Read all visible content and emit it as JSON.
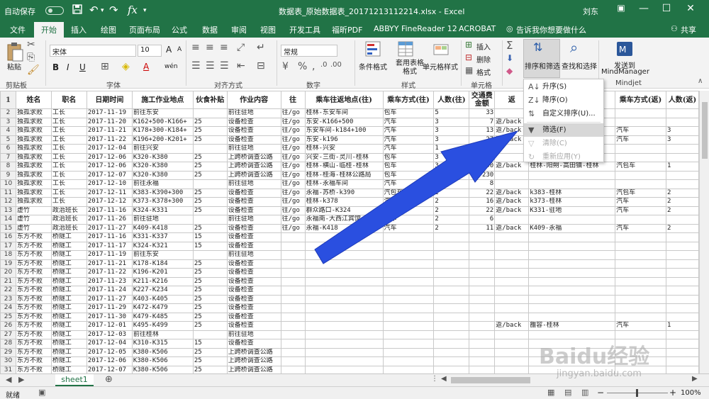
{
  "title_bar": {
    "autosave_label": "自动保存",
    "autosave_state": "关",
    "file_title": "数据表_原始数据表_20171213112214.xlsx - Excel",
    "user": "刘东",
    "accent": "#217346"
  },
  "ribbon_tabs": [
    "文件",
    "开始",
    "插入",
    "绘图",
    "页面布局",
    "公式",
    "数据",
    "审阅",
    "视图",
    "开发工具",
    "福昕PDF",
    "ABBYY FineReader 12",
    "ACROBAT",
    "告诉我你想要做什么"
  ],
  "share_label": "共享",
  "ribbon": {
    "clipboard": {
      "paste": "粘贴",
      "group": "剪贴板"
    },
    "font": {
      "name": "宋体",
      "size": "10",
      "bold": "B",
      "italic": "I",
      "underline": "U",
      "grow": "A",
      "shrink": "A",
      "phonetic": "wén",
      "group": "字体"
    },
    "alignment": {
      "group": "对齐方式"
    },
    "number": {
      "format": "常规",
      "group": "数字"
    },
    "styles": {
      "conditional": "条件格式",
      "table": "套用表格格式",
      "cell": "单元格样式",
      "group": "样式"
    },
    "cells": {
      "insert": "插入",
      "delete": "删除",
      "format": "格式",
      "group": "单元格"
    },
    "editing": {
      "sort_filter": "排序和筛选",
      "find": "查找和选择",
      "group": "编辑"
    },
    "mindjet": {
      "send": "发送到",
      "app": "MindManager",
      "group": "Mindjet"
    }
  },
  "sort_menu": {
    "items": [
      {
        "label": "升序(S)",
        "icon": "sort-ascending-icon",
        "enabled": true
      },
      {
        "label": "降序(O)",
        "icon": "sort-descending-icon",
        "enabled": true
      },
      {
        "label": "自定义排序(U)...",
        "icon": "custom-sort-icon",
        "enabled": true
      },
      {
        "label": "筛选(F)",
        "icon": "filter-icon",
        "enabled": true
      },
      {
        "label": "清除(C)",
        "icon": "clear-filter-icon",
        "enabled": false
      },
      {
        "label": "重新应用(Y)",
        "icon": "reapply-icon",
        "enabled": false
      }
    ]
  },
  "sheet": {
    "headers": [
      "姓名",
      "职名",
      "日期时间",
      "施工作业地点",
      "伙食补贴",
      "作业内容",
      "往",
      "乘车往返地点(往)",
      "乘车方式(往)",
      "人数(往)",
      "交通费金额",
      "返",
      "乘车往返地点(返)",
      "乘车方式(返)",
      "人数(返)"
    ],
    "rows": [
      [
        "独孤求败",
        "工长",
        "2017-11-19",
        "前往东安",
        "",
        "前往驻地",
        "往/go",
        "桂林-东安车间",
        "包车",
        "5",
        "33",
        "",
        "",
        "",
        ""
      ],
      [
        "独孤求败",
        "工长",
        "2017-11-20",
        "K162+500-K166+",
        "25",
        "设备检查",
        "往/go",
        "东安-K166+500",
        "汽车",
        "3",
        "7",
        "返/back",
        "",
        "",
        ""
      ],
      [
        "独孤求败",
        "工长",
        "2017-11-21",
        "K178+300-K184+",
        "25",
        "设备检查",
        "往/go",
        "东安车间-k184+100",
        "汽车",
        "3",
        "13",
        "返/back",
        "",
        "汽车",
        "3"
      ],
      [
        "独孤求败",
        "工长",
        "2017-11-22",
        "K196+200-K201+",
        "25",
        "设备检查",
        "往/go",
        "东安-k196",
        "汽车",
        "3",
        "27",
        "返/back",
        "",
        "汽车",
        "3"
      ],
      [
        "独孤求败",
        "工长",
        "2017-12-04",
        "前往兴安",
        "",
        "前往驻地",
        "往/go",
        "桂林-兴安",
        "汽车",
        "1",
        "20",
        "",
        "",
        "",
        ""
      ],
      [
        "独孤求败",
        "工长",
        "2017-12-06",
        "K320-K380",
        "25",
        "上跨桥调查公路",
        "往/go",
        "兴安-三街-灵川-桂林",
        "包车",
        "3",
        "330",
        "",
        "",
        "",
        ""
      ],
      [
        "独孤求败",
        "工长",
        "2017-12-06",
        "K320-K380",
        "25",
        "上跨桥调查公路",
        "往/go",
        "桂林-横山-临桂-桂林",
        "包车",
        "3",
        "190",
        "返/back",
        "桂林-阳朔-高田镇-桂林",
        "汽包车",
        "1"
      ],
      [
        "独孤求败",
        "工长",
        "2017-12-07",
        "K320-K380",
        "25",
        "上跨桥调查公路",
        "往/go",
        "桂林-桂海-桂林公路局",
        "包车",
        "3",
        "230",
        "",
        "",
        "",
        ""
      ],
      [
        "独孤求败",
        "工长",
        "2017-12-10",
        "前往永福",
        "",
        "前往驻地",
        "往/go",
        "桂林-永福车间",
        "汽车",
        "",
        "8",
        "",
        "",
        "",
        ""
      ],
      [
        "独孤求败",
        "工长",
        "2017-12-11",
        "K383-K390+300",
        "25",
        "设备检查",
        "往/go",
        "永福-苏桥-k390",
        "汽包车",
        "2",
        "22",
        "返/back",
        "k383-桂林",
        "汽包车",
        "2"
      ],
      [
        "独孤求败",
        "工长",
        "2017-12-12",
        "K373-K378+300",
        "25",
        "设备检查",
        "往/go",
        "桂林-k378",
        "汽车",
        "2",
        "16",
        "返/back",
        "k373-桂林",
        "汽车",
        "2"
      ],
      [
        "虚竹",
        "政治班长",
        "2017-11-16",
        "K324-K331",
        "25",
        "设备检查",
        "往/go",
        "群众路口-K324",
        "汽车",
        "2",
        "22",
        "返/back",
        "K331-驻地",
        "汽车",
        "2"
      ],
      [
        "虚竹",
        "政治班长",
        "2017-11-26",
        "前往驻地",
        "",
        "前往驻地",
        "往/go",
        "永福南-大西江宾馆",
        "汽车",
        "2",
        "6",
        "",
        "",
        "",
        ""
      ],
      [
        "虚竹",
        "政治班长",
        "2017-11-27",
        "K409-K418",
        "25",
        "设备检查",
        "往/go",
        "永福-K418",
        "汽车",
        "2",
        "11",
        "返/back",
        "K409-永福",
        "汽车",
        "2"
      ],
      [
        "东方不败",
        "桥隧工",
        "2017-11-16",
        "K331-K337",
        "15",
        "设备检查",
        "",
        "",
        "",
        "",
        "",
        "",
        "",
        "",
        ""
      ],
      [
        "东方不败",
        "桥隧工",
        "2017-11-17",
        "K324-K321",
        "15",
        "设备检查",
        "",
        "",
        "",
        "",
        "",
        "",
        "",
        "",
        ""
      ],
      [
        "东方不败",
        "桥隧工",
        "2017-11-19",
        "前往东安",
        "",
        "前往驻地",
        "",
        "",
        "",
        "",
        "",
        "",
        "",
        "",
        ""
      ],
      [
        "东方不败",
        "桥隧工",
        "2017-11-21",
        "K178-K184",
        "25",
        "设备检查",
        "",
        "",
        "",
        "",
        "",
        "",
        "",
        "",
        ""
      ],
      [
        "东方不败",
        "桥隧工",
        "2017-11-22",
        "K196-K201",
        "25",
        "设备检查",
        "",
        "",
        "",
        "",
        "",
        "",
        "",
        "",
        ""
      ],
      [
        "东方不败",
        "桥隧工",
        "2017-11-23",
        "K211-K216",
        "25",
        "设备检查",
        "",
        "",
        "",
        "",
        "",
        "",
        "",
        "",
        ""
      ],
      [
        "东方不败",
        "桥隧工",
        "2017-11-24",
        "K227-K234",
        "25",
        "设备检查",
        "",
        "",
        "",
        "",
        "",
        "",
        "",
        "",
        ""
      ],
      [
        "东方不败",
        "桥隧工",
        "2017-11-27",
        "K403-K405",
        "25",
        "设备检查",
        "",
        "",
        "",
        "",
        "",
        "",
        "",
        "",
        ""
      ],
      [
        "东方不败",
        "桥隧工",
        "2017-11-29",
        "K472-K479",
        "25",
        "设备检查",
        "",
        "",
        "",
        "",
        "",
        "",
        "",
        "",
        ""
      ],
      [
        "东方不败",
        "桥隧工",
        "2017-11-30",
        "K479-K485",
        "25",
        "设备检查",
        "",
        "",
        "",
        "",
        "",
        "",
        "",
        "",
        ""
      ],
      [
        "东方不败",
        "桥隧工",
        "2017-12-01",
        "K495-K499",
        "25",
        "设备检查",
        "",
        "",
        "",
        "",
        "",
        "返/back",
        "雒容-桂林",
        "汽车",
        "1"
      ],
      [
        "东方不败",
        "桥隧工",
        "2017-12-03",
        "前往桂林",
        "",
        "前往驻地",
        "",
        "",
        "",
        "",
        "",
        "",
        "",
        "",
        ""
      ],
      [
        "东方不败",
        "桥隧工",
        "2017-12-04",
        "K310-K315",
        "15",
        "设备检查",
        "",
        "",
        "",
        "",
        "",
        "",
        "",
        "",
        ""
      ],
      [
        "东方不败",
        "桥隧工",
        "2017-12-05",
        "K380-K506",
        "25",
        "上跨桥调查公路",
        "",
        "",
        "",
        "",
        "",
        "",
        "",
        "",
        ""
      ],
      [
        "东方不败",
        "桥隧工",
        "2017-12-06",
        "K380-K506",
        "25",
        "上跨桥调查公路",
        "",
        "",
        "",
        "",
        "",
        "",
        "",
        "",
        ""
      ],
      [
        "东方不败",
        "桥隧工",
        "2017-12-07",
        "K380-K506",
        "25",
        "上跨桥调查公路",
        "",
        "",
        "",
        "",
        "",
        "",
        "",
        "",
        ""
      ]
    ]
  },
  "sheet_tab": "sheet1",
  "status": {
    "ready": "就绪",
    "zoom": "100%"
  },
  "watermark": {
    "logo": "Baidu经验",
    "url": "jingyan.baidu.com"
  }
}
